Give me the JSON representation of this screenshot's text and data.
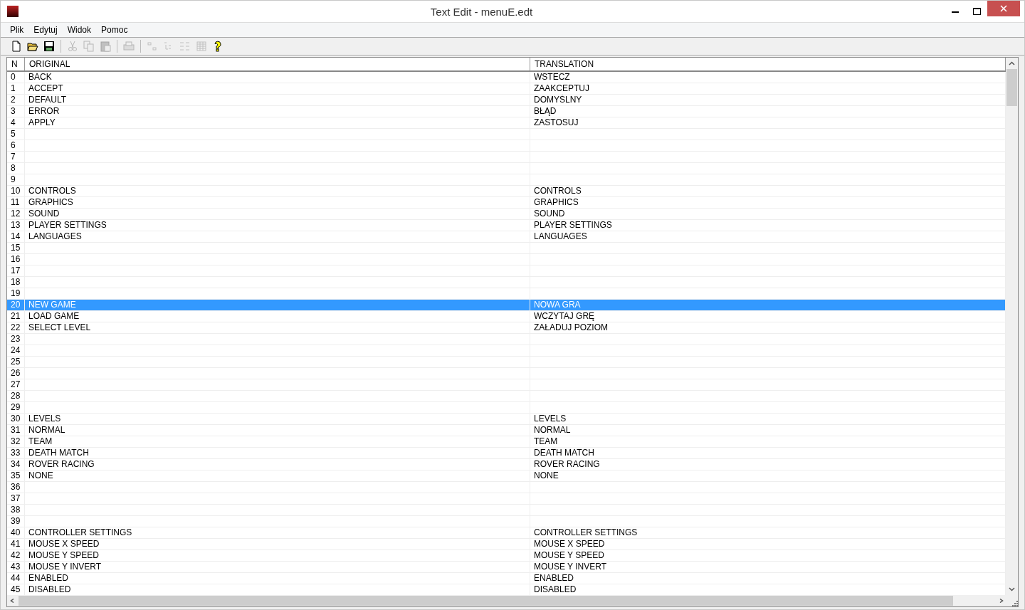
{
  "window": {
    "title": "Text Edit - menuE.edt"
  },
  "menu": [
    "Plik",
    "Edytuj",
    "Widok",
    "Pomoc"
  ],
  "toolbar": [
    {
      "kind": "new",
      "disabled": false
    },
    {
      "kind": "open",
      "disabled": false
    },
    {
      "kind": "save",
      "disabled": false
    },
    {
      "kind": "sep"
    },
    {
      "kind": "cut",
      "disabled": true
    },
    {
      "kind": "copy",
      "disabled": true
    },
    {
      "kind": "paste",
      "disabled": true
    },
    {
      "kind": "sep"
    },
    {
      "kind": "print",
      "disabled": true
    },
    {
      "kind": "sep"
    },
    {
      "kind": "view1",
      "disabled": true
    },
    {
      "kind": "view2",
      "disabled": true
    },
    {
      "kind": "view3",
      "disabled": true
    },
    {
      "kind": "view4",
      "disabled": true
    },
    {
      "kind": "help",
      "disabled": false
    }
  ],
  "table": {
    "columns": [
      "N",
      "ORIGINAL",
      "TRANSLATION"
    ],
    "rows": [
      {
        "n": "0",
        "original": "BACK",
        "translation": "WSTECZ",
        "selected": false
      },
      {
        "n": "1",
        "original": "ACCEPT",
        "translation": "ZAAKCEPTUJ",
        "selected": false
      },
      {
        "n": "2",
        "original": "DEFAULT",
        "translation": "DOMYŚLNY",
        "selected": false
      },
      {
        "n": "3",
        "original": "ERROR",
        "translation": "BŁĄD",
        "selected": false
      },
      {
        "n": "4",
        "original": "APPLY",
        "translation": "ZASTOSUJ",
        "selected": false
      },
      {
        "n": "5",
        "selected": false
      },
      {
        "n": "6",
        "selected": false
      },
      {
        "n": "7",
        "selected": false
      },
      {
        "n": "8",
        "selected": false
      },
      {
        "n": "9",
        "selected": false
      },
      {
        "n": "10",
        "original": "CONTROLS",
        "translation": "CONTROLS",
        "selected": false
      },
      {
        "n": "11",
        "original": "GRAPHICS",
        "translation": "GRAPHICS",
        "selected": false
      },
      {
        "n": "12",
        "original": "SOUND",
        "translation": "SOUND",
        "selected": false
      },
      {
        "n": "13",
        "original": "PLAYER SETTINGS",
        "translation": "PLAYER SETTINGS",
        "selected": false
      },
      {
        "n": "14",
        "original": "LANGUAGES",
        "translation": "LANGUAGES",
        "selected": false
      },
      {
        "n": "15",
        "selected": false
      },
      {
        "n": "16",
        "selected": false
      },
      {
        "n": "17",
        "selected": false
      },
      {
        "n": "18",
        "selected": false
      },
      {
        "n": "19",
        "selected": false
      },
      {
        "n": "20",
        "original": "NEW GAME",
        "translation": "NOWA GRA",
        "selected": true
      },
      {
        "n": "21",
        "original": "LOAD GAME",
        "translation": "WCZYTAJ GRĘ",
        "selected": false
      },
      {
        "n": "22",
        "original": "SELECT LEVEL",
        "translation": "ZAŁADUJ POZIOM",
        "selected": false
      },
      {
        "n": "23",
        "selected": false
      },
      {
        "n": "24",
        "selected": false
      },
      {
        "n": "25",
        "selected": false
      },
      {
        "n": "26",
        "selected": false
      },
      {
        "n": "27",
        "selected": false
      },
      {
        "n": "28",
        "selected": false
      },
      {
        "n": "29",
        "selected": false
      },
      {
        "n": "30",
        "original": "LEVELS",
        "translation": "LEVELS",
        "selected": false
      },
      {
        "n": "31",
        "original": "NORMAL",
        "translation": "NORMAL",
        "selected": false
      },
      {
        "n": "32",
        "original": "TEAM",
        "translation": "TEAM",
        "selected": false
      },
      {
        "n": "33",
        "original": "DEATH MATCH",
        "translation": "DEATH MATCH",
        "selected": false
      },
      {
        "n": "34",
        "original": "ROVER RACING",
        "translation": "ROVER RACING",
        "selected": false
      },
      {
        "n": "35",
        "original": "NONE",
        "translation": "NONE",
        "selected": false
      },
      {
        "n": "36",
        "selected": false
      },
      {
        "n": "37",
        "selected": false
      },
      {
        "n": "38",
        "selected": false
      },
      {
        "n": "39",
        "selected": false
      },
      {
        "n": "40",
        "original": "CONTROLLER SETTINGS",
        "translation": "CONTROLLER SETTINGS",
        "selected": false
      },
      {
        "n": "41",
        "original": "MOUSE X SPEED",
        "translation": "MOUSE X SPEED",
        "selected": false
      },
      {
        "n": "42",
        "original": "MOUSE Y SPEED",
        "translation": "MOUSE Y SPEED",
        "selected": false
      },
      {
        "n": "43",
        "original": "MOUSE Y INVERT",
        "translation": "MOUSE Y INVERT",
        "selected": false
      },
      {
        "n": "44",
        "original": "ENABLED",
        "translation": "ENABLED",
        "selected": false
      },
      {
        "n": "45",
        "original": "DISABLED",
        "translation": "DISABLED",
        "selected": false
      }
    ]
  }
}
